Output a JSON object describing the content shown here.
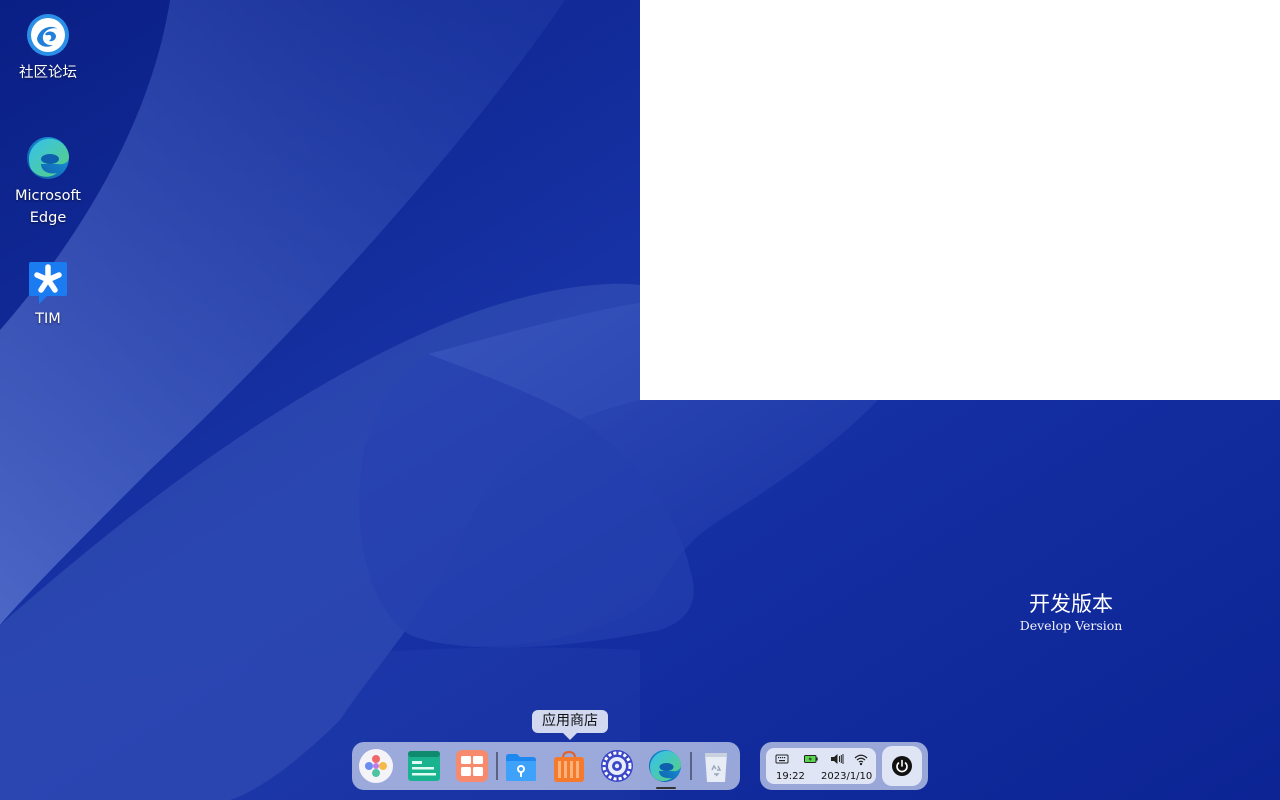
{
  "desktop": {
    "icons": [
      {
        "label": "社区论坛",
        "icon": "deepin-forum-icon"
      },
      {
        "label": "Microsoft Edge",
        "label_line1": "Microsoft",
        "label_line2": "Edge",
        "icon": "edge-icon"
      },
      {
        "label": "TIM",
        "icon": "tim-icon"
      }
    ],
    "watermark": {
      "title": "开发版本",
      "subtitle": "Develop Version"
    }
  },
  "dock": {
    "tooltip": "应用商店",
    "items": [
      {
        "icon": "launcher-icon"
      },
      {
        "icon": "terminal-icon"
      },
      {
        "icon": "multitask-view-icon"
      },
      {
        "icon": "file-manager-icon"
      },
      {
        "icon": "app-store-icon",
        "name": "应用商店"
      },
      {
        "icon": "control-center-icon"
      },
      {
        "icon": "edge-icon",
        "active": true
      },
      {
        "icon": "trash-icon"
      }
    ]
  },
  "tray": {
    "time": "19:22",
    "date": "2023/1/10",
    "icons": [
      "keyboard-icon",
      "battery-icon",
      "volume-icon",
      "wifi-icon"
    ],
    "power_icon": "power-icon"
  },
  "colors": {
    "wallpaper_base": "#0d2a9c",
    "wallpaper_light": "#3e5bbf",
    "dock_bg": "#cdd7f0",
    "window_bg": "#ffffff"
  }
}
